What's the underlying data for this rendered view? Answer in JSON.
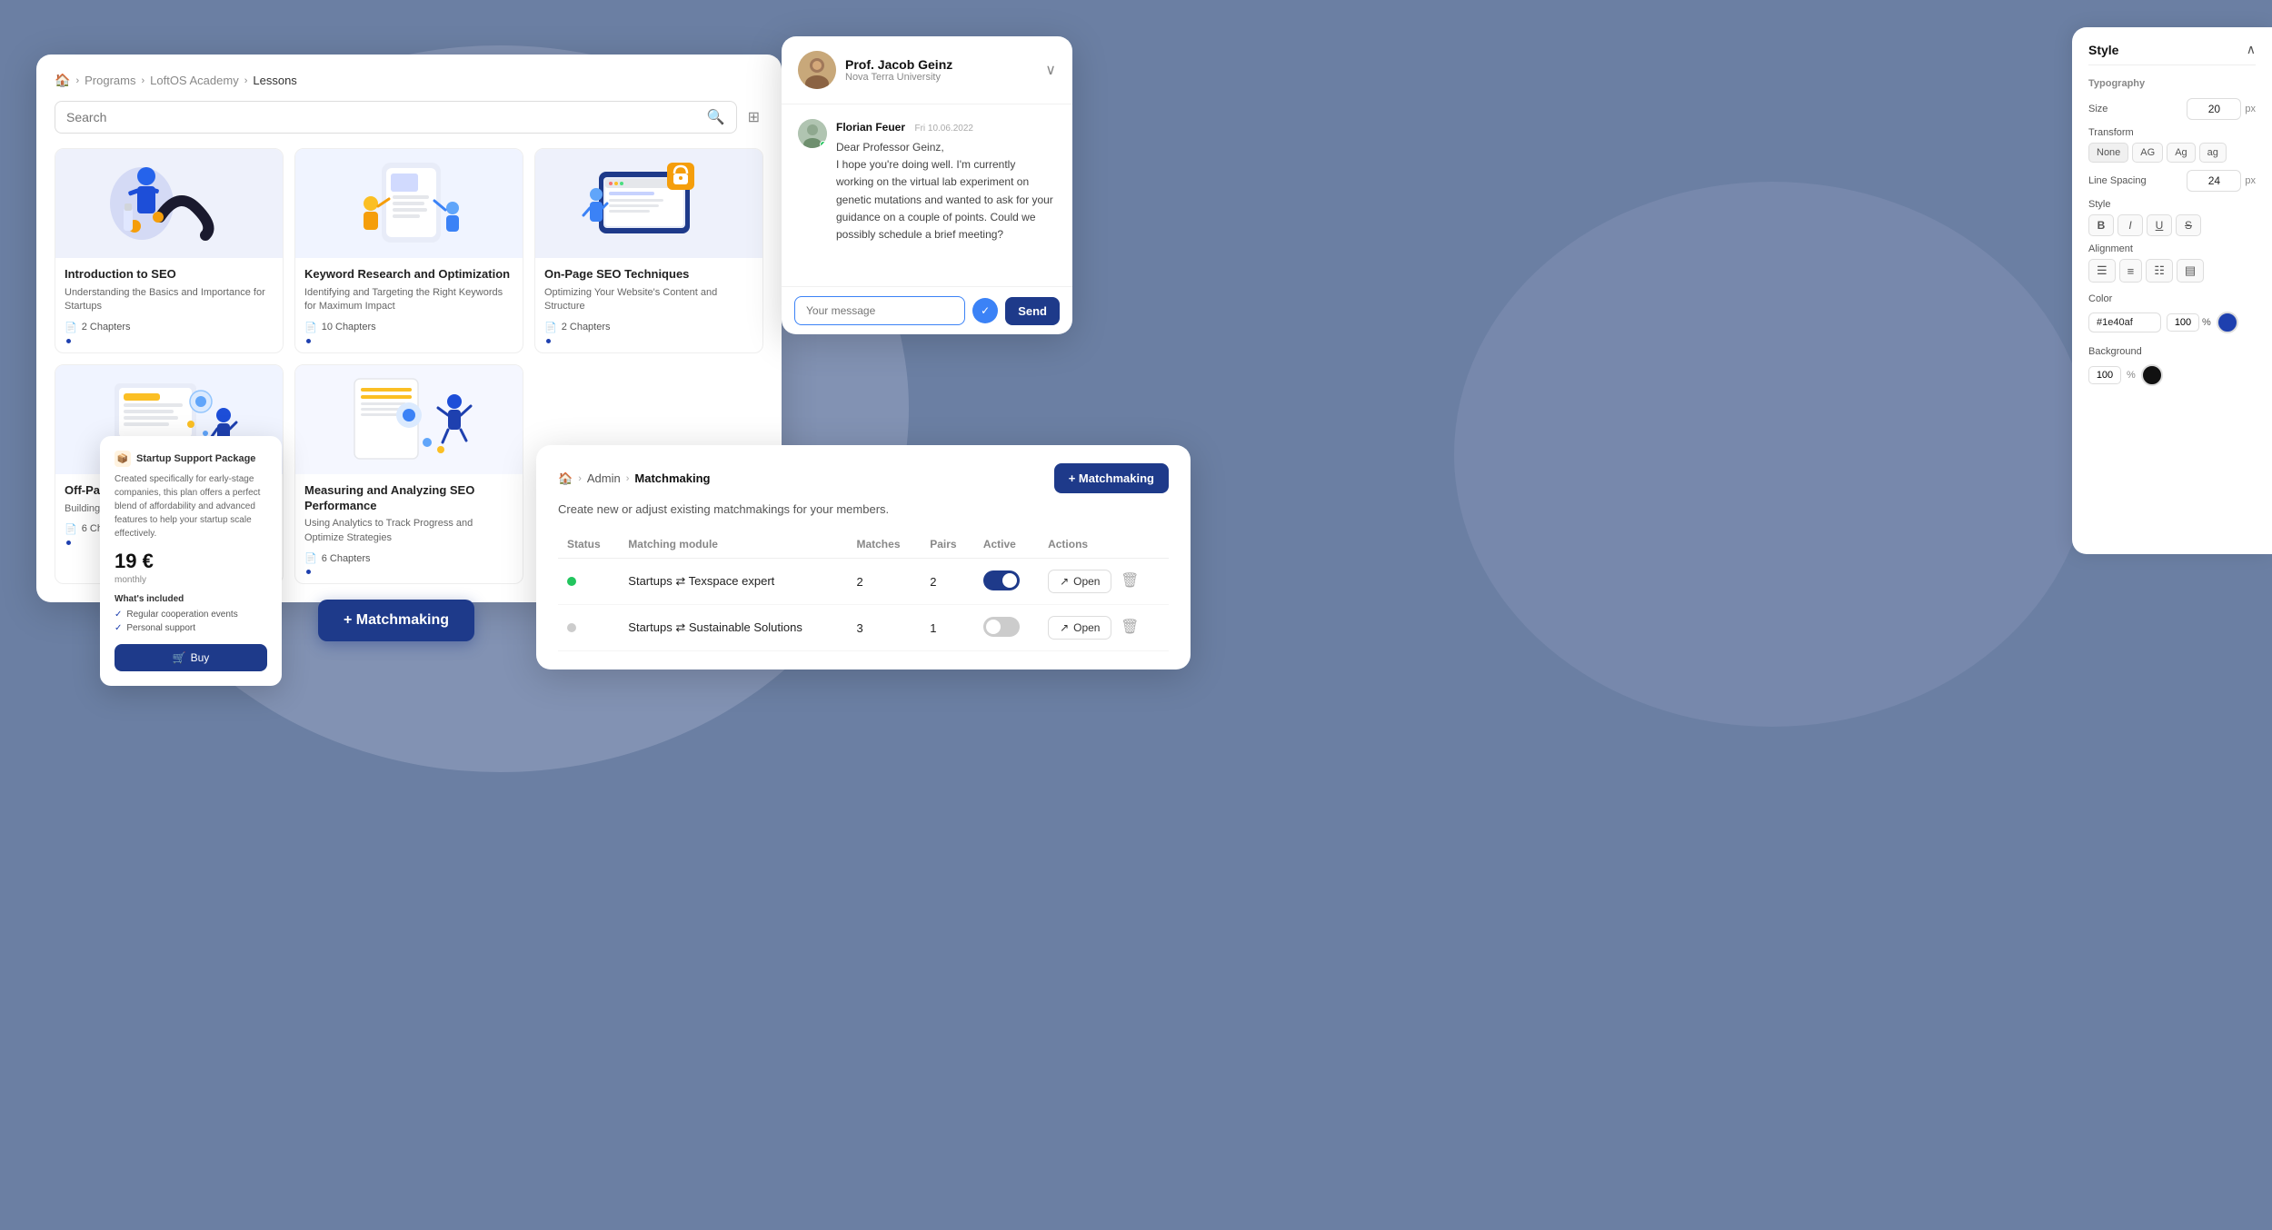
{
  "background": "#6b7fa3",
  "lessons_panel": {
    "breadcrumb": [
      "🏠",
      "Programs",
      "LoftOS Academy",
      "Lessons"
    ],
    "search_placeholder": "Search",
    "filter_icon": "⊟",
    "lessons": [
      {
        "id": "seo-intro",
        "title": "Introduction to SEO",
        "subtitle": "Understanding the Basics and Importance for Startups",
        "chapters": "2 Chapters",
        "has_dot": true,
        "illustration": "seo"
      },
      {
        "id": "keyword-research",
        "title": "Keyword Research and Optimization",
        "subtitle": "Identifying and Targeting the Right Keywords for Maximum Impact",
        "chapters": "10 Chapters",
        "has_dot": true,
        "illustration": "keyword"
      },
      {
        "id": "onpage-seo",
        "title": "On-Page SEO Techniques",
        "subtitle": "Optimizing Your Website's Content and Structure",
        "chapters": "2 Chapters",
        "has_dot": true,
        "illustration": "onpage"
      },
      {
        "id": "offpage-seo",
        "title": "Off-Page SEO",
        "subtitle": "Building Authority and Improving Rankings",
        "chapters": "6 Chapters",
        "has_dot": true,
        "illustration": "offpage"
      },
      {
        "id": "measuring-seo",
        "title": "Measuring and Analyzing SEO Performance",
        "subtitle": "Using Analytics to Track Progress and Optimize Strategies",
        "chapters": "6 Chapters",
        "has_dot": true,
        "illustration": "measuring"
      }
    ]
  },
  "price_popup": {
    "badge": "Startup Support Package",
    "description": "Created specifically for early-stage companies, this plan offers a perfect blend of affordability and advanced features to help your startup scale effectively.",
    "price": "19 €",
    "period": "monthly",
    "included_label": "What's included",
    "features": [
      "Regular cooperation events",
      "Personal support"
    ],
    "buy_label": "Buy"
  },
  "matchmaking_btn": {
    "label": "+ Matchmaking"
  },
  "chat_panel": {
    "professor": {
      "name": "Prof. Jacob Geinz",
      "org": "Nova Terra University"
    },
    "message": {
      "sender": "Florian Feuer",
      "date": "Fri 10.06.2022",
      "text": "Dear Professor Geinz,\nI hope you're doing well. I'm currently working on the virtual lab experiment on genetic mutations and wanted to ask for your guidance on a couple of points. Could we possibly schedule a brief meeting?"
    },
    "input_placeholder": "Your message",
    "send_label": "Send"
  },
  "matchmaking_panel": {
    "breadcrumb": [
      "🏠",
      "Admin",
      "Matchmaking"
    ],
    "add_btn_label": "+ Matchmaking",
    "subtitle": "Create new or adjust existing matchmakings for your members.",
    "table": {
      "headers": [
        "Status",
        "Matching module",
        "Matches",
        "Pairs",
        "Active",
        "Actions"
      ],
      "rows": [
        {
          "status": "active",
          "module": "Startups ⇄ Texspace expert",
          "matches": "2",
          "pairs": "2",
          "active": true,
          "open_label": "Open"
        },
        {
          "status": "inactive",
          "module": "Startups ⇄ Sustainable Solutions",
          "matches": "3",
          "pairs": "1",
          "active": false,
          "open_label": "Open"
        }
      ]
    }
  },
  "style_panel": {
    "title": "Style",
    "close_icon": "✕",
    "typography_label": "Typography",
    "size_label": "Size",
    "size_value": "20",
    "size_unit": "px",
    "transform_label": "Transform",
    "transform_options": [
      "None",
      "AG",
      "Ag",
      "ag"
    ],
    "line_spacing_label": "Line Spacing",
    "line_spacing_value": "24",
    "line_spacing_unit": "px",
    "style_label": "Style",
    "style_options": [
      "B",
      "I",
      "U",
      "S"
    ],
    "alignment_label": "Alignment",
    "color_label": "Color",
    "color_hex": "#1e40af",
    "color_pct": "100",
    "color_pct_symbol": "%",
    "background_label": "Background",
    "bg_pct": "100",
    "bg_pct_symbol": "%"
  }
}
